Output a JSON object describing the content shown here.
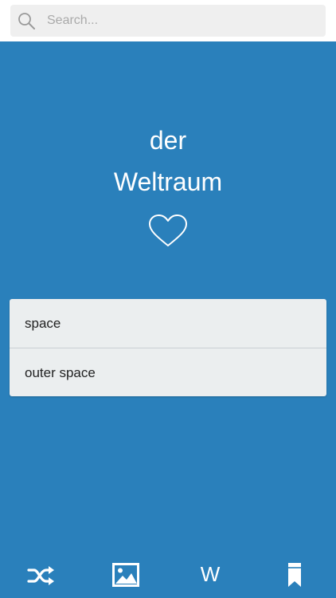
{
  "search": {
    "placeholder": "Search..."
  },
  "entry": {
    "article": "der",
    "word": "Weltraum"
  },
  "translations": [
    "space",
    "outer space"
  ],
  "bottom_nav": {
    "shuffle_icon": "shuffle-icon",
    "image_icon": "image-icon",
    "wiki_label": "W",
    "bookmark_icon": "bookmark-icon"
  },
  "colors": {
    "background": "#2a80bb",
    "card": "#ebeeef",
    "topbar": "#ffffff",
    "search_field": "#efefef"
  }
}
